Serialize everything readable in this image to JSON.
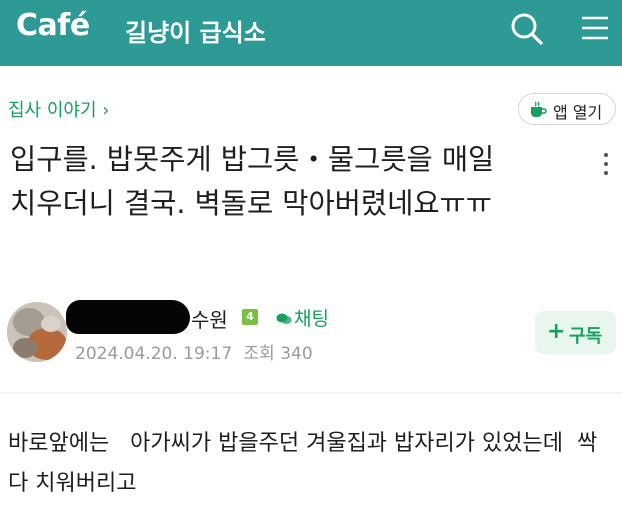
{
  "header": {
    "logo": "Café",
    "cafe_name": "길냥이 급식소",
    "search_icon": "search-icon",
    "menu_icon": "menu-icon",
    "background_color": "#2d9a96"
  },
  "board": {
    "label": "집사 이야기 ›"
  },
  "app_open": {
    "label": "앱 열기",
    "icon": "cup-icon"
  },
  "post": {
    "title": "입구를. 밥못주게 밥그릇・물그릇을 매일 치우더니 결국. 벽돌로 막아버렸네요ㅠㅠ",
    "author_name": "수원",
    "level_badge": "4",
    "chat_label": "채팅",
    "date": "2024.04.20. 19:17",
    "views_label": "조회 340",
    "subscribe_label": "구독",
    "body": "바로앞에는   아가씨가 밥을주던 겨울집과 밥자리가 있었는데  싹다 치워버리고"
  },
  "colors": {
    "accent_green": "#16a05c",
    "meta_gray": "#9a9a9a"
  }
}
